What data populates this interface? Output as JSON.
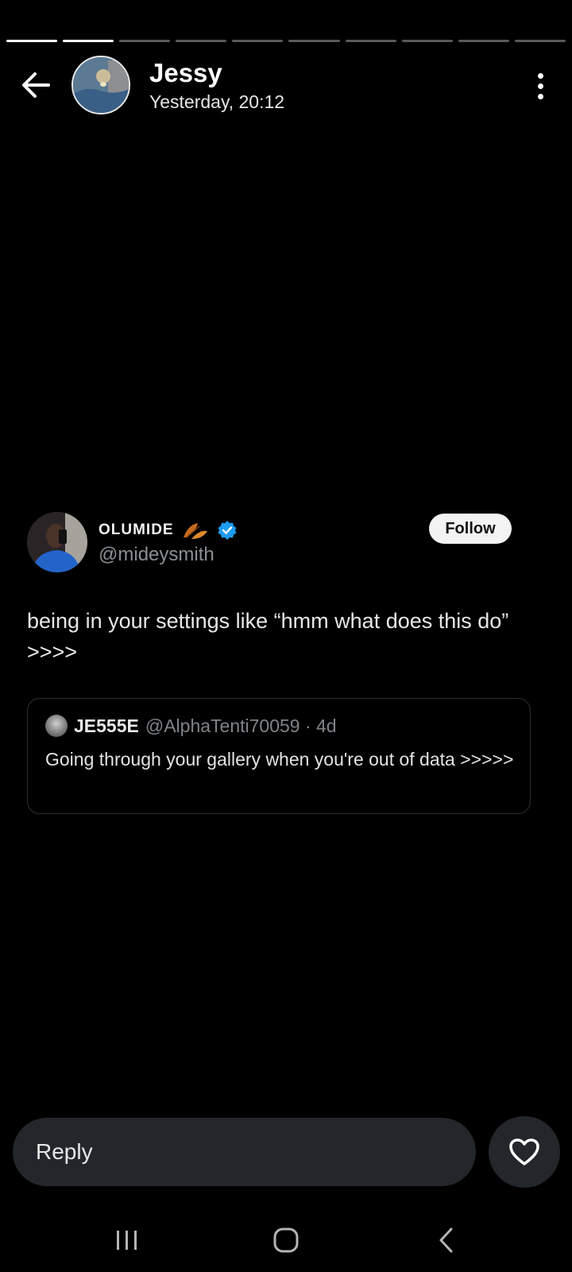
{
  "story": {
    "segment_count": 10,
    "segments_progress": [
      1,
      1,
      0,
      0,
      0,
      0,
      0,
      0,
      0,
      0
    ],
    "user_name": "Jessy",
    "timestamp": "Yesterday, 20:12"
  },
  "tweet": {
    "author_name": "OLUMIDE",
    "author_handle": "@mideysmith",
    "follow_label": "Follow",
    "text": "being in your settings like “hmm what does this do” >>>>",
    "quoted": {
      "author_name": "JE555E",
      "meta": "@AlphaTenti70059 · 4d",
      "text": "Going through your gallery when you're out of data >>>>>"
    }
  },
  "footer": {
    "reply_placeholder": "Reply"
  },
  "icons": {
    "back": "arrow-left-icon",
    "more": "more-vertical-icon",
    "verified": "verified-badge-icon",
    "like": "heart-icon",
    "nav_recents": "recents-icon",
    "nav_home": "home-icon",
    "nav_back": "nav-back-icon"
  },
  "colors": {
    "background": "#000000",
    "verified": "#1d9bf0",
    "reply_bar": "#23272b"
  }
}
